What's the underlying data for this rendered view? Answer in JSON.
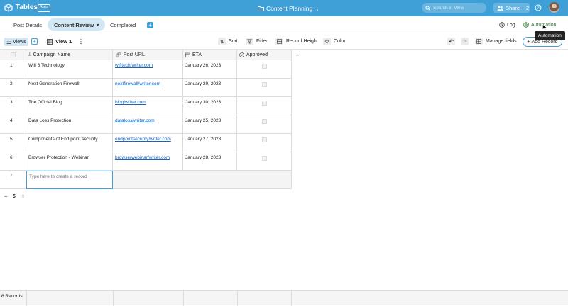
{
  "app": {
    "title": "Tables",
    "badge": "Beta",
    "document": "Content Planning"
  },
  "search": {
    "placeholder": "Search in View"
  },
  "share": {
    "label": "Share",
    "count": "2"
  },
  "tabs": [
    {
      "label": "Post Details",
      "active": false
    },
    {
      "label": "Content Review",
      "active": true
    },
    {
      "label": "Completed",
      "active": false
    }
  ],
  "header_actions": {
    "log": "Log",
    "automation": "Automation",
    "tooltip": "Automation"
  },
  "toolbar": {
    "views": "Views",
    "view_name": "View 1",
    "sort": "Sort",
    "filter": "Filter",
    "record_height": "Record Height",
    "color": "Color",
    "manage_fields": "Manage fields",
    "add_record": "Add Record"
  },
  "columns": [
    {
      "label": "Campaign Name",
      "icon": "text-icon"
    },
    {
      "label": "Post URL",
      "icon": "link-icon"
    },
    {
      "label": "ETA",
      "icon": "calendar-icon"
    },
    {
      "label": "Approved",
      "icon": "check-circle-icon"
    }
  ],
  "rows": [
    {
      "num": "1",
      "campaign": "Wifi 6 Technology",
      "url": "wifitech/writer.com",
      "eta": "January 26, 2023"
    },
    {
      "num": "2",
      "campaign": "Next Generation Firewall",
      "url": "nextfirewall/writer.com",
      "eta": "January 29, 2023"
    },
    {
      "num": "3",
      "campaign": "The Official Blog",
      "url": "blog/writer.com",
      "eta": "January 30, 2023"
    },
    {
      "num": "4",
      "campaign": "Data Loss Protection",
      "url": "dataloss/writer.com",
      "eta": "January 25, 2023"
    },
    {
      "num": "5",
      "campaign": "Components of End point security",
      "url": "endpointsecurity/writer.com",
      "eta": "January 27, 2023"
    },
    {
      "num": "6",
      "campaign": "Browser Protection - Webinar",
      "url": "browserwebinar/writer.com",
      "eta": "January 28, 2023"
    }
  ],
  "new_row": {
    "num": "7",
    "placeholder": "Type here to create a record"
  },
  "group": {
    "count": "5"
  },
  "footer": {
    "records": "6 Records"
  },
  "colors": {
    "accent": "#3ea0d6",
    "tab_active": "#d2e7f4",
    "automation": "#2e7d32",
    "link": "#1565c0"
  }
}
